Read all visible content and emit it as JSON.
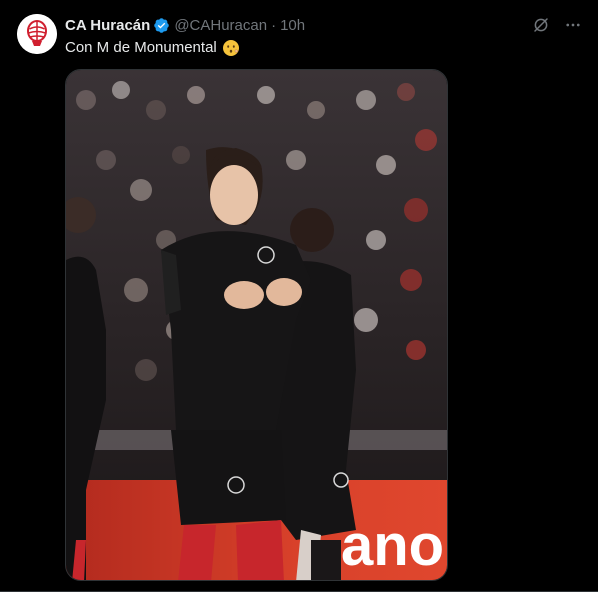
{
  "tweet": {
    "author_name": "CA Huracán",
    "handle": "@CAHuracan",
    "separator": "·",
    "time": "10h",
    "text": "Con M de Monumental",
    "emoji_icon": "hushed-face-emoji",
    "verified_color": "#1d9bf0"
  },
  "media": {
    "banner_text": "ano"
  },
  "colors": {
    "background": "#000000",
    "text_primary": "#e7e9ea",
    "text_secondary": "#71767b",
    "accent_red": "#d01f2f"
  }
}
